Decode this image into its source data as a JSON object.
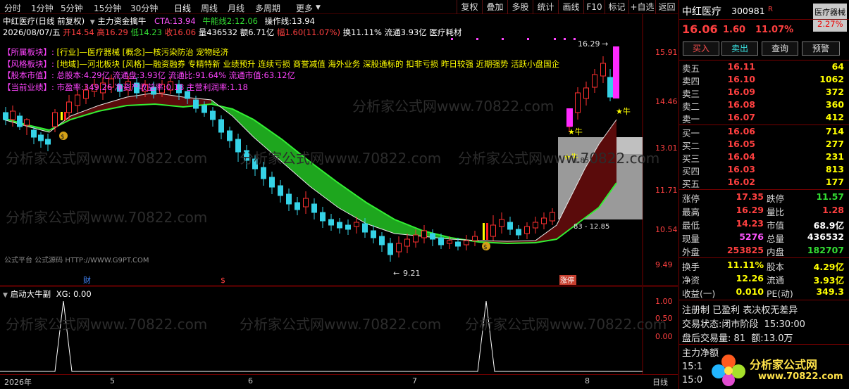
{
  "toolbar": {
    "periods": [
      "分时",
      "1分钟",
      "5分钟",
      "15分钟",
      "30分钟",
      "日线",
      "周线",
      "月线",
      "多周期",
      "更多"
    ],
    "active_period": "日线",
    "buttons": [
      "复权",
      "叠加",
      "多股",
      "统计",
      "画线",
      "F10",
      "标记",
      "+自选",
      "返回"
    ]
  },
  "header": {
    "title": "中红医疗(日线 前复权)",
    "indicator_name": "主力资金擒牛",
    "cta_label": "CTA:",
    "cta_value": "13.94",
    "niuneng_label": "牛能线2:",
    "niuneng_value": "12.06",
    "caozuo_label": "操作线:",
    "caozuo_value": "13.94"
  },
  "ohlc": {
    "date": "2026/08/07/五",
    "open": "开14.54",
    "high": "高16.29",
    "low": "低14.23",
    "close": "收16.06",
    "volume": "量436532",
    "amount": "额6.71亿",
    "change": "幅1.60(11.07%)",
    "turnover": "换11.11%",
    "float": "流通3.93亿",
    "sector": "医疗耗材"
  },
  "annotations": [
    {
      "tag": "【所属板块】:",
      "text": "[行业]—医疗器械 [概念]—核污染防治 宠物经济"
    },
    {
      "tag": "【风格板块】:",
      "text": "[地域]—河北板块 [风格]—融资融券 专精特新 业绩预升 连续亏损 商誉减值 海外业务 深股通标的 扣非亏损 昨日较强 近期强势 活跃小盘国企"
    },
    {
      "tag": "【股本市值】:",
      "text": "总股本:4.29亿 流通盘:3.93亿 流通比:91.64% 流通市值:63.12亿"
    },
    {
      "tag": "【当前业绩】:",
      "text": "市盈率:349.26 净资产收益率:0.18 主营利润率:1.18"
    }
  ],
  "price_axis": [
    "15.91",
    "14.46",
    "13.01",
    "11.71",
    "10.54",
    "9.49"
  ],
  "chart_labels": {
    "high_mark": "16.29",
    "low_mark": "9.21",
    "band_label_1": "1.85",
    "band_label_2": "83 - 12.85",
    "cai": "财",
    "dollar": "$",
    "zhang": "涨停",
    "watermark_left": "公式平台 公式源码 HTTP://WWW.G9PT.COM",
    "watermark_main": "分析家公式网www.70822.com",
    "niu": "★牛"
  },
  "sub_chart": {
    "title": "启动大牛副",
    "xg_label": "XG:",
    "xg_value": "0.00",
    "axis": [
      "1.00",
      "0.50",
      "0.00"
    ]
  },
  "x_axis": {
    "labels": [
      "2026年",
      "5",
      "6",
      "7",
      "8"
    ],
    "period_label": "日线"
  },
  "chart_data": {
    "type": "candlestick",
    "title": "中红医疗(日线 前复权)",
    "price_range": [
      9.2,
      16.3
    ],
    "highlighted_extremes": {
      "high": 16.29,
      "low": 9.21
    },
    "last_bar": {
      "date": "2026/08/07",
      "open": 14.54,
      "high": 16.29,
      "low": 14.23,
      "close": 16.06,
      "volume": 436532
    },
    "sub_indicator": {
      "name": "启动大牛副",
      "series": "XG",
      "current": 0.0,
      "signal_peaks": 2
    }
  },
  "panel": {
    "name": "中红医疗",
    "code": "300981",
    "r_badge": "R",
    "badge": "医疗器械",
    "badge_pct": "2.27%",
    "price": "16.06",
    "change": "1.60",
    "change_pct": "11.07%",
    "buttons": [
      "买入",
      "卖出",
      "查询",
      "预警"
    ],
    "sell": [
      {
        "label": "卖五",
        "price": "16.11",
        "vol": "64"
      },
      {
        "label": "卖四",
        "price": "16.10",
        "vol": "1062"
      },
      {
        "label": "卖三",
        "price": "16.09",
        "vol": "372"
      },
      {
        "label": "卖二",
        "price": "16.08",
        "vol": "360"
      },
      {
        "label": "卖一",
        "price": "16.07",
        "vol": "412"
      }
    ],
    "buy": [
      {
        "label": "买一",
        "price": "16.06",
        "vol": "714"
      },
      {
        "label": "买二",
        "price": "16.05",
        "vol": "277"
      },
      {
        "label": "买三",
        "price": "16.04",
        "vol": "231"
      },
      {
        "label": "买四",
        "price": "16.03",
        "vol": "813"
      },
      {
        "label": "买五",
        "price": "16.02",
        "vol": "177"
      }
    ],
    "stats": [
      {
        "k1": "涨停",
        "v1": "17.35",
        "k2": "跌停",
        "v2": "11.57"
      },
      {
        "k1": "最高",
        "v1": "16.29",
        "k2": "量比",
        "v2": "1.28"
      },
      {
        "k1": "最低",
        "v1": "14.23",
        "k2": "市值",
        "v2": "68.9亿"
      },
      {
        "k1": "现量",
        "v1": "5276",
        "k2": "总量",
        "v2": "436532"
      },
      {
        "k1": "外盘",
        "v1": "253825",
        "k2": "内盘",
        "v2": "182707"
      }
    ],
    "stats2": [
      {
        "k1": "换手",
        "v1": "11.11%",
        "k2": "股本",
        "v2": "4.29亿"
      },
      {
        "k1": "净资",
        "v1": "12.26",
        "k2": "流通",
        "v2": "3.93亿"
      },
      {
        "k1": "收益(一)",
        "v1": "0.010",
        "k2": "PE(动)",
        "v2": "349.3"
      }
    ],
    "reg_text": "注册制 已盈利 表决权无差异",
    "trade_status_label": "交易状态:",
    "trade_status": "闭市阶段",
    "trade_time": "15:30:00",
    "after_label": "盘后交易量:",
    "after_vol": "81",
    "after_amt_label": "额:",
    "after_amt": "13.0万",
    "main_label": "主力净额",
    "time_1": "15:1",
    "time_2": "15:0",
    "logo_text": "分析家公式网",
    "logo_url": "www.70822.com"
  }
}
